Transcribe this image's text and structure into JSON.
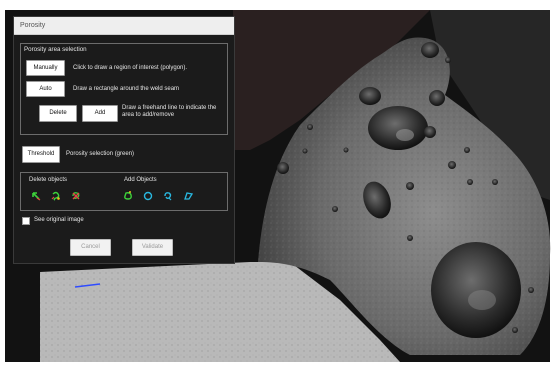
{
  "dialog": {
    "title": "Porosity",
    "area_group": {
      "title": "Porosity area selection",
      "manual_label": "Manually",
      "manual_desc": "Click to draw a region of interest (polygon).",
      "auto_label": "Auto",
      "auto_desc": "Draw a rectangle around the weld seam",
      "delete_label": "Delete",
      "add_label": "Add",
      "freehand_desc": "Draw a freehand line to indicate the area to add/remove"
    },
    "threshold_label": "Threshold",
    "threshold_desc": "Porosity selection (green)",
    "objects_group": {
      "delete_title": "Delete objects",
      "add_title": "Add Objects",
      "delete_icons": [
        "arrow-cursor-icon",
        "scribble-icon",
        "lasso-delete-icon"
      ],
      "add_icons": [
        "blob-add-icon",
        "circle-icon",
        "loop-icon",
        "polygon-icon"
      ],
      "icon_colors": {
        "green": "#3cd13a",
        "red": "#e04545",
        "cyan": "#29b8e0",
        "yellow": "#e6c020"
      }
    },
    "see_original_label": "See original image",
    "see_original_checked": false,
    "cancel_label": "Cancel",
    "validate_label": "Validate"
  }
}
